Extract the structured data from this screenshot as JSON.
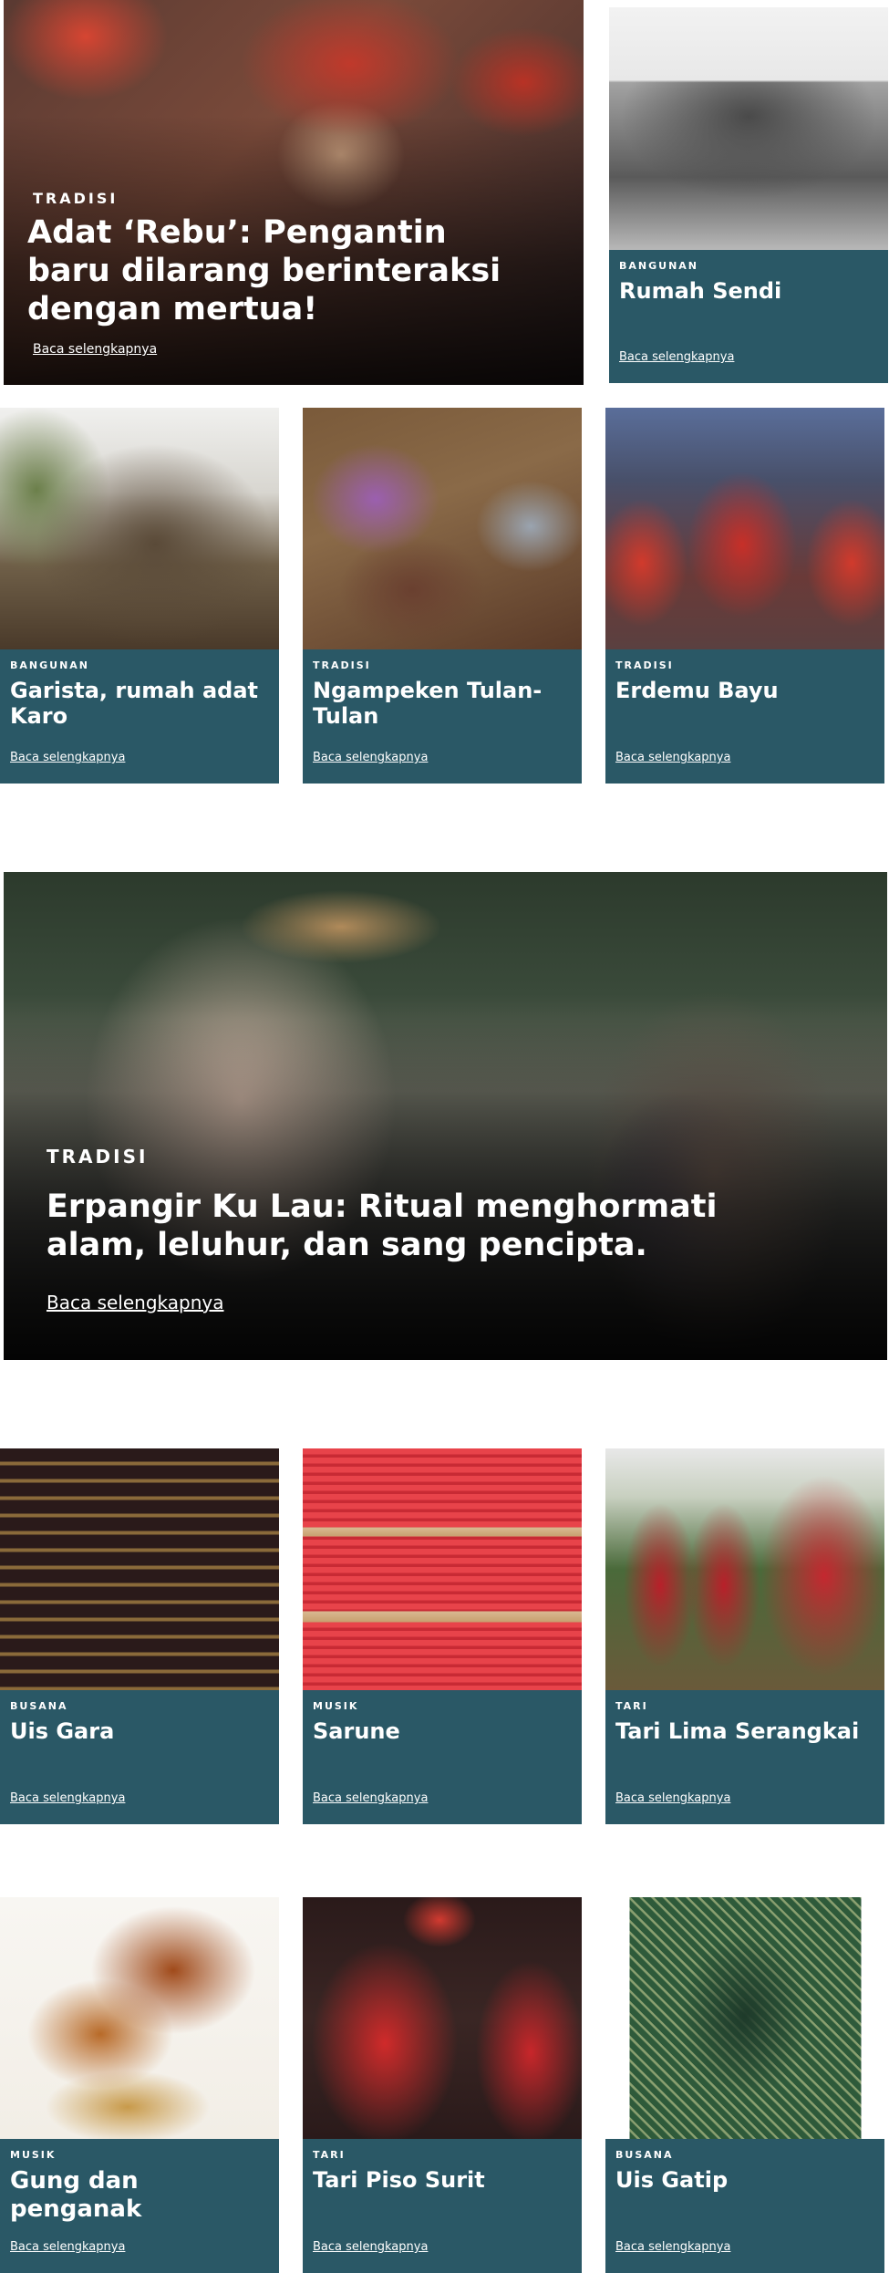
{
  "hero_top": {
    "category": "TRADISI",
    "title": "Adat ‘Rebu’: Pengantin baru dilarang berinteraksi dengan mertua!",
    "read_more": "Baca selengkapnya"
  },
  "row1_side": {
    "category": "BANGUNAN",
    "title": "Rumah Sendi",
    "read_more": "Baca selengkapnya"
  },
  "row2": [
    {
      "category": "BANGUNAN",
      "title": "Garista, rumah adat Karo",
      "read_more": "Baca selengkapnya"
    },
    {
      "category": "TRADISI",
      "title": "Ngampeken Tulan-Tulan",
      "read_more": "Baca selengkapnya"
    },
    {
      "category": "TRADISI",
      "title": "Erdemu Bayu",
      "read_more": "Baca selengkapnya"
    }
  ],
  "hero_mid": {
    "category": "TRADISI",
    "title": "Erpangir Ku Lau: Ritual menghormati alam, leluhur, dan sang pencipta.",
    "read_more": "Baca selengkapnya"
  },
  "row3": [
    {
      "category": "BUSANA",
      "title": "Uis Gara",
      "read_more": "Baca selengkapnya"
    },
    {
      "category": "MUSIK",
      "title": "Sarune",
      "read_more": "Baca selengkapnya"
    },
    {
      "category": "TARI",
      "title": "Tari Lima Serangkai",
      "read_more": "Baca selengkapnya"
    }
  ],
  "row4": [
    {
      "category": "MUSIK",
      "title": "Gung dan penganak",
      "read_more": "Baca selengkapnya"
    },
    {
      "category": "TARI",
      "title": "Tari Piso Surit",
      "read_more": "Baca selengkapnya"
    },
    {
      "category": "BUSANA",
      "title": "Uis Gatip",
      "read_more": "Baca selengkapnya"
    }
  ],
  "colors": {
    "panel": "#2a5866",
    "text": "#ffffff",
    "background": "#ffffff"
  }
}
